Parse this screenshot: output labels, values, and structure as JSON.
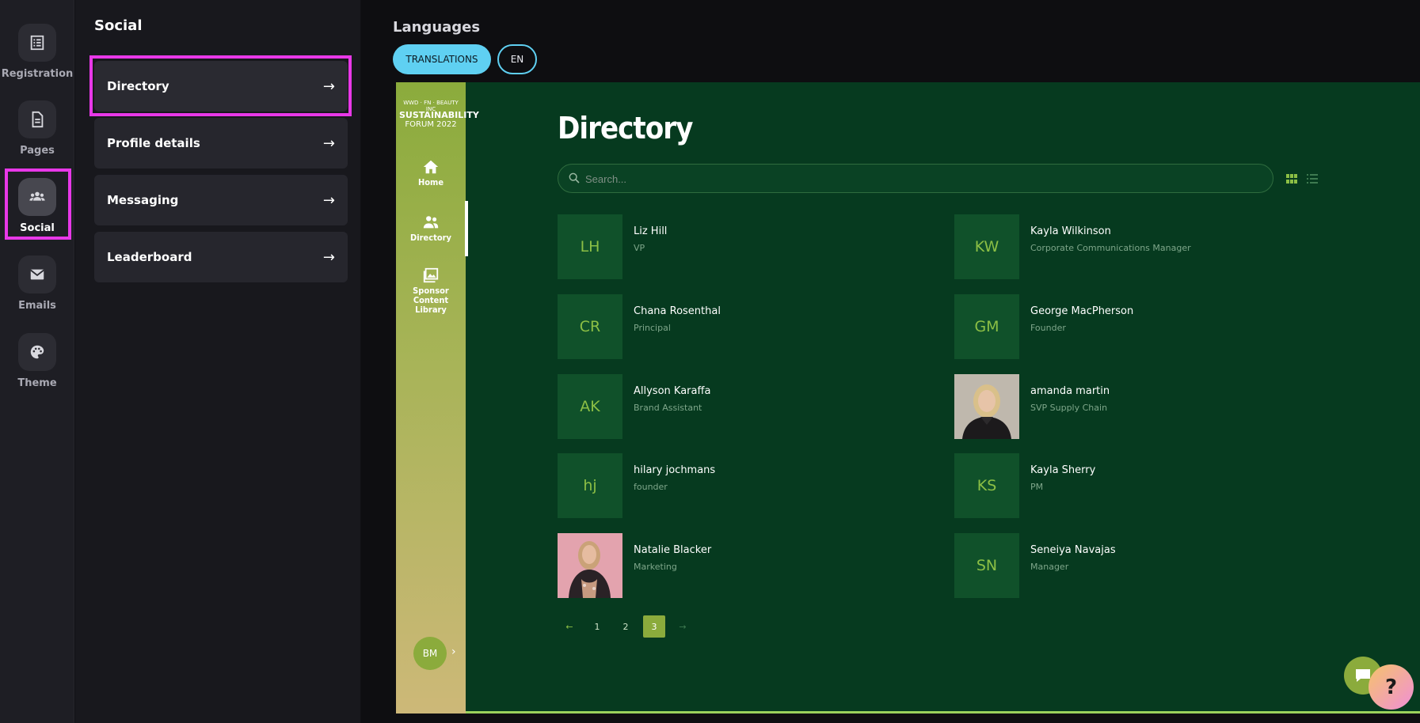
{
  "rail": {
    "items": [
      {
        "label": "Registration",
        "icon": "registration-icon"
      },
      {
        "label": "Pages",
        "icon": "pages-icon"
      },
      {
        "label": "Social",
        "icon": "social-icon"
      },
      {
        "label": "Emails",
        "icon": "mail-icon"
      },
      {
        "label": "Theme",
        "icon": "palette-icon"
      }
    ]
  },
  "subnav": {
    "title": "Social",
    "items": [
      {
        "label": "Directory",
        "arrow": "→"
      },
      {
        "label": "Profile details",
        "arrow": "→"
      },
      {
        "label": "Messaging",
        "arrow": "→"
      },
      {
        "label": "Leaderboard",
        "arrow": "→"
      }
    ]
  },
  "languages": {
    "title": "Languages",
    "translations_label": "TRANSLATIONS",
    "en_label": "EN"
  },
  "preview": {
    "logo_small": "WWD · FN · BEAUTY INC",
    "logo_title": "SUSTAINABILITY",
    "logo_year": "FORUM 2022",
    "nav": [
      {
        "label": "Home",
        "icon": "home-icon"
      },
      {
        "label": "Directory",
        "icon": "people-icon"
      },
      {
        "label": "Sponsor Content Library",
        "icon": "image-gallery-icon"
      }
    ],
    "user_initials": "BM",
    "user_chevron": "›",
    "title": "Directory",
    "search_placeholder": "Search...",
    "people": [
      {
        "initials": "LH",
        "name": "Liz Hill",
        "role": "VP"
      },
      {
        "initials": "KW",
        "name": "Kayla Wilkinson",
        "role": "Corporate Communications Manager"
      },
      {
        "initials": "CR",
        "name": "Chana Rosenthal",
        "role": "Principal"
      },
      {
        "initials": "GM",
        "name": "George MacPherson",
        "role": "Founder"
      },
      {
        "initials": "AK",
        "name": "Allyson Karaffa",
        "role": "Brand Assistant"
      },
      {
        "initials": "",
        "name": "amanda martin",
        "role": "SVP Supply Chain"
      },
      {
        "initials": "hj",
        "name": "hilary jochmans",
        "role": "founder"
      },
      {
        "initials": "KS",
        "name": "Kayla Sherry",
        "role": "PM"
      },
      {
        "initials": "",
        "name": "Natalie Blacker",
        "role": "Marketing"
      },
      {
        "initials": "SN",
        "name": "Seneiya Navajas",
        "role": "Manager"
      }
    ],
    "pagination": {
      "prev": "←",
      "pages": [
        "1",
        "2",
        "3"
      ],
      "current": "3",
      "next": "→"
    }
  },
  "widgets": {
    "help_label": "?"
  },
  "colors": {
    "accent_cyan": "#5fd0f2",
    "highlight_magenta": "#e838e8",
    "preview_bg": "#063a1f",
    "preview_accent": "#8bab3c"
  }
}
